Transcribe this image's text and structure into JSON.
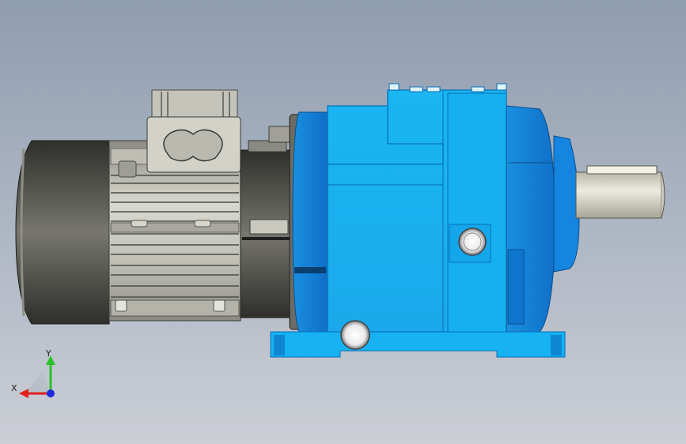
{
  "viewport": {
    "background_top": "#8f9db0",
    "background_bottom": "#c9ccd3"
  },
  "model": {
    "housing_color": "#1ab8f5",
    "housing_shadow": "#0b88c8",
    "housing_dark": "#0a5fa8",
    "motor_color": "#c9c9c0",
    "motor_dark": "#5a5a55",
    "shaft_color": "#d8d6c8"
  },
  "triad": {
    "x_label": "X",
    "y_label": "Y",
    "x_color": "#e0201c",
    "y_color": "#2ac02a",
    "z_color": "#1c2ae0"
  }
}
